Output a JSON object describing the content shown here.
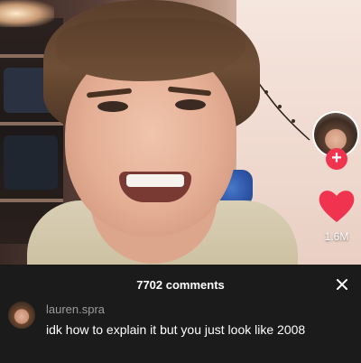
{
  "video": {
    "like_count": "1.6M"
  },
  "colors": {
    "like": "#f0344f",
    "follow": "#f0344f",
    "panel_bg": "#1b1b1b"
  },
  "icons": {
    "close": "close-icon",
    "like": "heart-icon",
    "follow": "plus-icon"
  },
  "comments_panel": {
    "title": "7702 comments",
    "comments": [
      {
        "username": "lauren.spra",
        "text": "idk how to explain it but you just look like 2008"
      }
    ]
  }
}
